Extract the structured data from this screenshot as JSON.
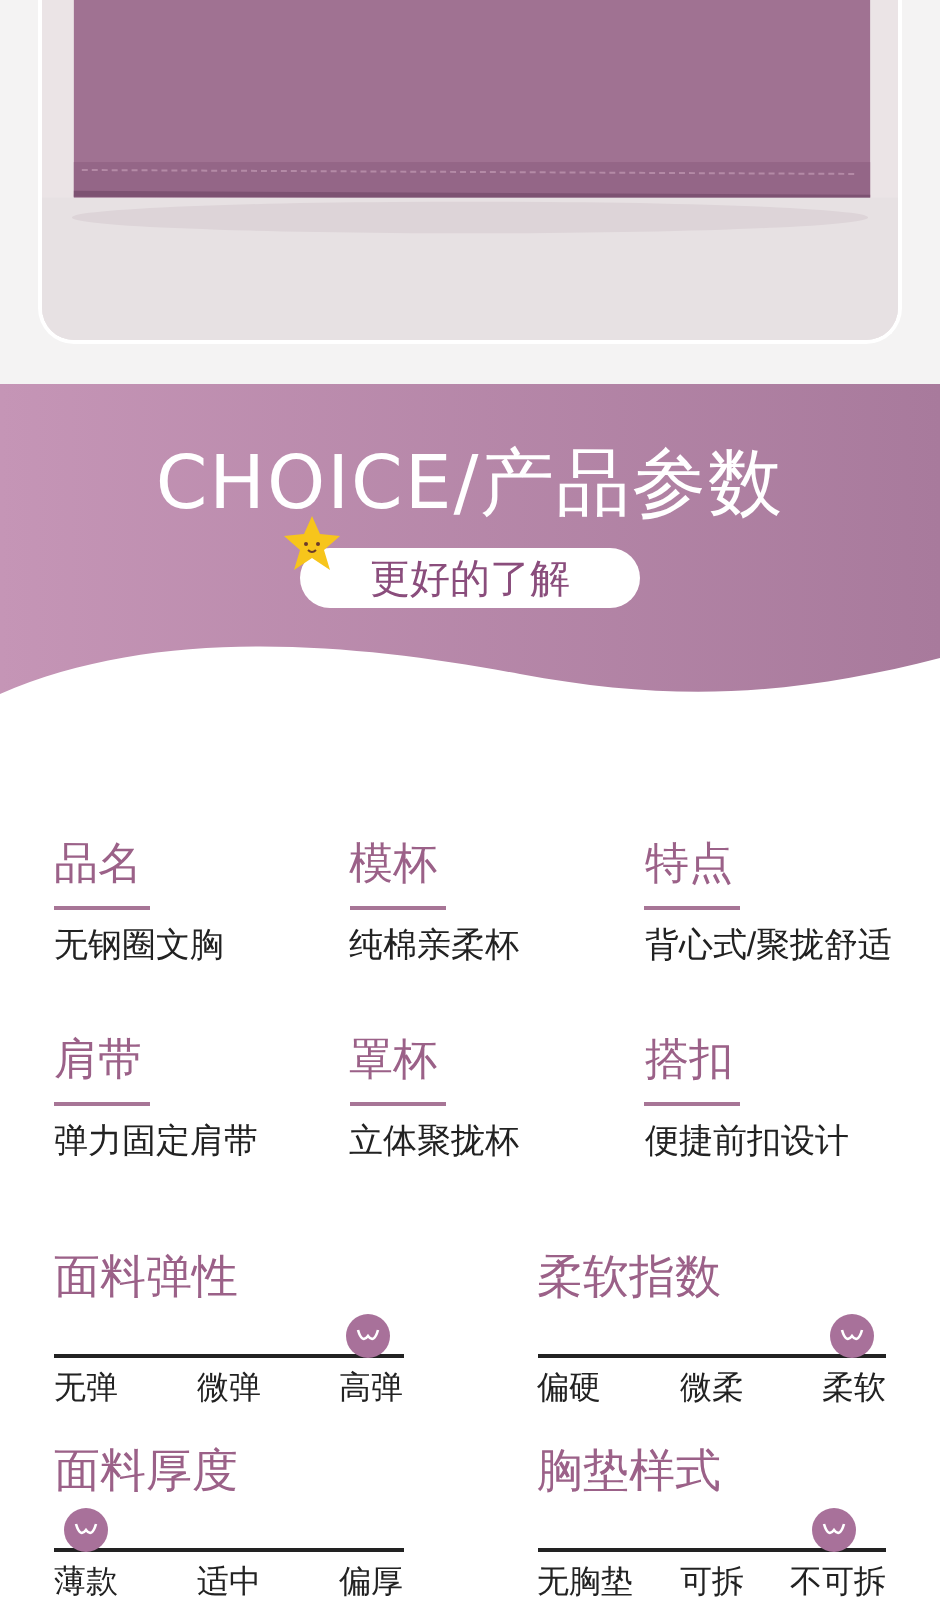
{
  "banner": {
    "title": "CHOICE/产品参数",
    "subtitle": "更好的了解"
  },
  "params": [
    {
      "label": "品名",
      "value": "无钢圈文胸"
    },
    {
      "label": "模杯",
      "value": "纯棉亲柔杯"
    },
    {
      "label": "特点",
      "value": "背心式/聚拢舒适"
    },
    {
      "label": "肩带",
      "value": "弹力固定肩带"
    },
    {
      "label": "罩杯",
      "value": "立体聚拢杯"
    },
    {
      "label": "搭扣",
      "value": "便捷前扣设计"
    }
  ],
  "scales": [
    {
      "title": "面料弹性",
      "level": 0.9,
      "ticks": [
        "无弹",
        "微弹",
        "高弹"
      ]
    },
    {
      "title": "柔软指数",
      "level": 0.9,
      "ticks": [
        "偏硬",
        "微柔",
        "柔软"
      ]
    },
    {
      "title": "面料厚度",
      "level": 0.09,
      "ticks": [
        "薄款",
        "适中",
        "偏厚"
      ]
    },
    {
      "title": "胸垫样式",
      "level": 0.85,
      "ticks": [
        "无胸垫",
        "可拆",
        "不可拆"
      ]
    }
  ]
}
